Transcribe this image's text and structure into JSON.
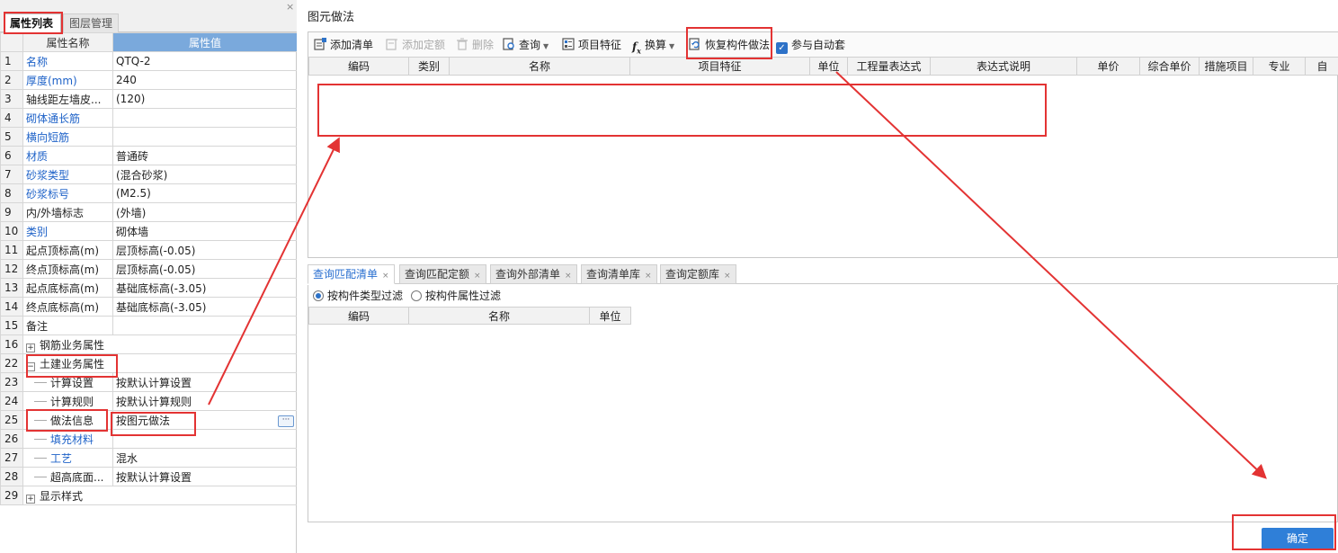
{
  "left_panel": {
    "tabs": [
      {
        "label": "属性列表",
        "active": true
      },
      {
        "label": "图层管理",
        "active": false
      }
    ],
    "close_glyph": "×",
    "columns": {
      "name": "属性名称",
      "value": "属性值"
    },
    "rows": [
      {
        "idx": "1",
        "name": "名称",
        "value": "QTQ-2",
        "blue": true
      },
      {
        "idx": "2",
        "name": "厚度(mm)",
        "value": "240",
        "blue": true
      },
      {
        "idx": "3",
        "name": "轴线距左墙皮...",
        "value": "(120)",
        "blue": false
      },
      {
        "idx": "4",
        "name": "砌体通长筋",
        "value": "",
        "blue": true
      },
      {
        "idx": "5",
        "name": "横向短筋",
        "value": "",
        "blue": true
      },
      {
        "idx": "6",
        "name": "材质",
        "value": "普通砖",
        "blue": true
      },
      {
        "idx": "7",
        "name": "砂浆类型",
        "value": "(混合砂浆)",
        "blue": true
      },
      {
        "idx": "8",
        "name": "砂浆标号",
        "value": "(M2.5)",
        "blue": true
      },
      {
        "idx": "9",
        "name": "内/外墙标志",
        "value": "(外墙)",
        "blue": false
      },
      {
        "idx": "10",
        "name": "类别",
        "value": "砌体墙",
        "blue": true
      },
      {
        "idx": "11",
        "name": "起点顶标高(m)",
        "value": "层顶标高(-0.05)",
        "blue": false
      },
      {
        "idx": "12",
        "name": "终点顶标高(m)",
        "value": "层顶标高(-0.05)",
        "blue": false
      },
      {
        "idx": "13",
        "name": "起点底标高(m)",
        "value": "基础底标高(-3.05)",
        "blue": false
      },
      {
        "idx": "14",
        "name": "终点底标高(m)",
        "value": "基础底标高(-3.05)",
        "blue": false
      },
      {
        "idx": "15",
        "name": "备注",
        "value": "",
        "blue": false
      },
      {
        "idx": "16",
        "name": "钢筋业务属性",
        "value": "",
        "group": true,
        "sign": "+"
      },
      {
        "idx": "22",
        "name": "土建业务属性",
        "value": "",
        "group": true,
        "sign": "−"
      },
      {
        "idx": "23",
        "name": "计算设置",
        "value": "按默认计算设置",
        "child": true
      },
      {
        "idx": "24",
        "name": "计算规则",
        "value": "按默认计算规则",
        "child": true
      },
      {
        "idx": "25",
        "name": "做法信息",
        "value": "按图元做法",
        "child": true,
        "selected": true,
        "button": "···"
      },
      {
        "idx": "26",
        "name": "填充材料",
        "value": "",
        "child": true,
        "blue": true
      },
      {
        "idx": "27",
        "name": "工艺",
        "value": "混水",
        "child": true,
        "blue": true
      },
      {
        "idx": "28",
        "name": "超高底面...",
        "value": "按默认计算设置",
        "child": true
      },
      {
        "idx": "29",
        "name": "显示样式",
        "value": "",
        "group": true,
        "sign": "+"
      }
    ]
  },
  "dialog": {
    "title": "图元做法",
    "toolbar": {
      "add_list": "添加清单",
      "add_quota": "添加定额",
      "delete": "删除",
      "query": "查询",
      "project_feature": "项目特征",
      "convert": "换算",
      "restore": "恢复构件做法",
      "auto_apply": "参与自动套",
      "auto_apply_checked": true
    },
    "upper_columns": [
      "编码",
      "类别",
      "名称",
      "项目特征",
      "单位",
      "工程量表达式",
      "表达式说明",
      "单价",
      "综合单价",
      "措施项目",
      "专业",
      "自"
    ],
    "lower_tabs": [
      {
        "label": "查询匹配清单",
        "active": true
      },
      {
        "label": "查询匹配定额",
        "active": false
      },
      {
        "label": "查询外部清单",
        "active": false
      },
      {
        "label": "查询清单库",
        "active": false
      },
      {
        "label": "查询定额库",
        "active": false
      }
    ],
    "filters": [
      {
        "label": "按构件类型过滤",
        "checked": true
      },
      {
        "label": "按构件属性过滤",
        "checked": false
      }
    ],
    "lower_columns": [
      "编码",
      "名称",
      "单位"
    ],
    "ok_label": "确定"
  },
  "colors": {
    "accent": "#2f7fd8",
    "annotation": "#e33333",
    "header_value": "#7aa9dc"
  }
}
